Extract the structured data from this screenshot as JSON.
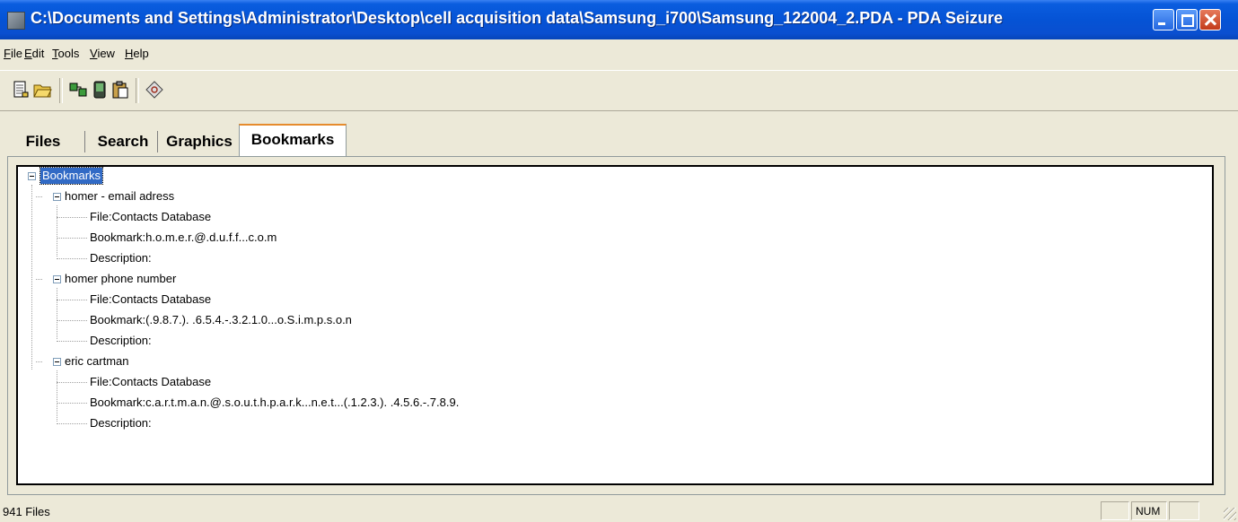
{
  "window": {
    "title": "C:\\Documents and Settings\\Administrator\\Desktop\\cell acquisition data\\Samsung_i700\\Samsung_122004_2.PDA - PDA Seizure"
  },
  "menu": [
    "File",
    "Edit",
    "Tools",
    "View",
    "Help"
  ],
  "toolbar": {
    "buttons": [
      "new-document-icon",
      "open-folder-icon",
      "acquire-icon",
      "device-icon",
      "clipboard-icon",
      "lock-icon"
    ]
  },
  "tabs": [
    "Files",
    "Search",
    "Graphics",
    "Bookmarks"
  ],
  "active_tab": "Bookmarks",
  "tree": {
    "root": "Bookmarks",
    "groups": [
      {
        "label": "homer - email adress",
        "items": [
          "File:Contacts Database",
          "Bookmark:h.o.m.e.r.@.d.u.f.f...c.o.m",
          "Description:"
        ]
      },
      {
        "label": "homer phone number",
        "items": [
          "File:Contacts Database",
          "Bookmark:(.9.8.7.). .6.5.4.-.3.2.1.0...o.S.i.m.p.s.o.n",
          "Description:"
        ]
      },
      {
        "label": "eric cartman",
        "items": [
          "File:Contacts Database",
          "Bookmark:c.a.r.t.m.a.n.@.s.o.u.t.h.p.a.r.k...n.e.t...(.1.2.3.). .4.5.6.-.7.8.9.",
          "Description:"
        ]
      }
    ]
  },
  "status": {
    "text": "941 Files",
    "num": "NUM"
  },
  "colors": {
    "titlebar": "#0553d5",
    "selection": "#316ac5",
    "tab_accent": "#e68b2c"
  }
}
